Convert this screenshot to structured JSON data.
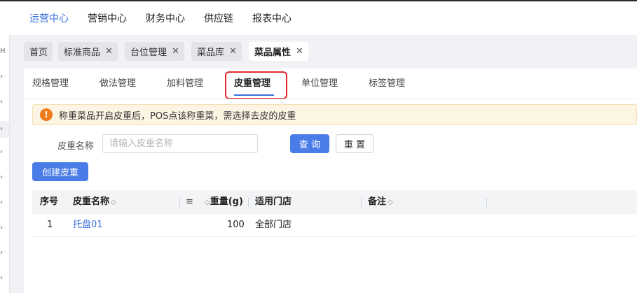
{
  "top_nav": [
    {
      "label": "运营中心",
      "active": true
    },
    {
      "label": "营销中心"
    },
    {
      "label": "财务中心"
    },
    {
      "label": "供应链"
    },
    {
      "label": "报表中心"
    }
  ],
  "sidebar": {
    "partial_glyph": "H",
    "arrow": "›"
  },
  "tabs": [
    {
      "label": "首页",
      "closable": false
    },
    {
      "label": "标准商品",
      "closable": true
    },
    {
      "label": "台位管理",
      "closable": true
    },
    {
      "label": "菜品库",
      "closable": true
    },
    {
      "label": "菜品属性",
      "closable": true,
      "active": true
    }
  ],
  "close_glyph": "✕",
  "subtabs": [
    {
      "label": "规格管理"
    },
    {
      "label": "做法管理"
    },
    {
      "label": "加料管理"
    },
    {
      "label": "皮重管理",
      "active": true
    },
    {
      "label": "单位管理"
    },
    {
      "label": "标签管理"
    }
  ],
  "alert": {
    "icon": "!",
    "text": "称重菜品开启皮重后，POS点该称重菜，需选择去皮的皮重"
  },
  "search": {
    "label": "皮重名称",
    "placeholder": "请输入皮重名称",
    "query_button": "查 询",
    "reset_button": "重 置"
  },
  "create_button": "创建皮重",
  "table": {
    "columns": [
      {
        "label": "序号"
      },
      {
        "label": "皮重名称",
        "sortable": true
      },
      {
        "label": "重量(g)",
        "sortable": true
      },
      {
        "label": "适用门店"
      },
      {
        "label": "备注",
        "sortable": true
      }
    ],
    "menu_icon": "≡",
    "sort_glyph": "◇",
    "rows": [
      {
        "index": "1",
        "name": "托盘01",
        "weight": "100",
        "stores": "全部门店",
        "remark": ""
      }
    ]
  },
  "colors": {
    "accent": "#4a7ce8",
    "highlight_box": "#e12b2b",
    "warning": "#f07b1a"
  }
}
